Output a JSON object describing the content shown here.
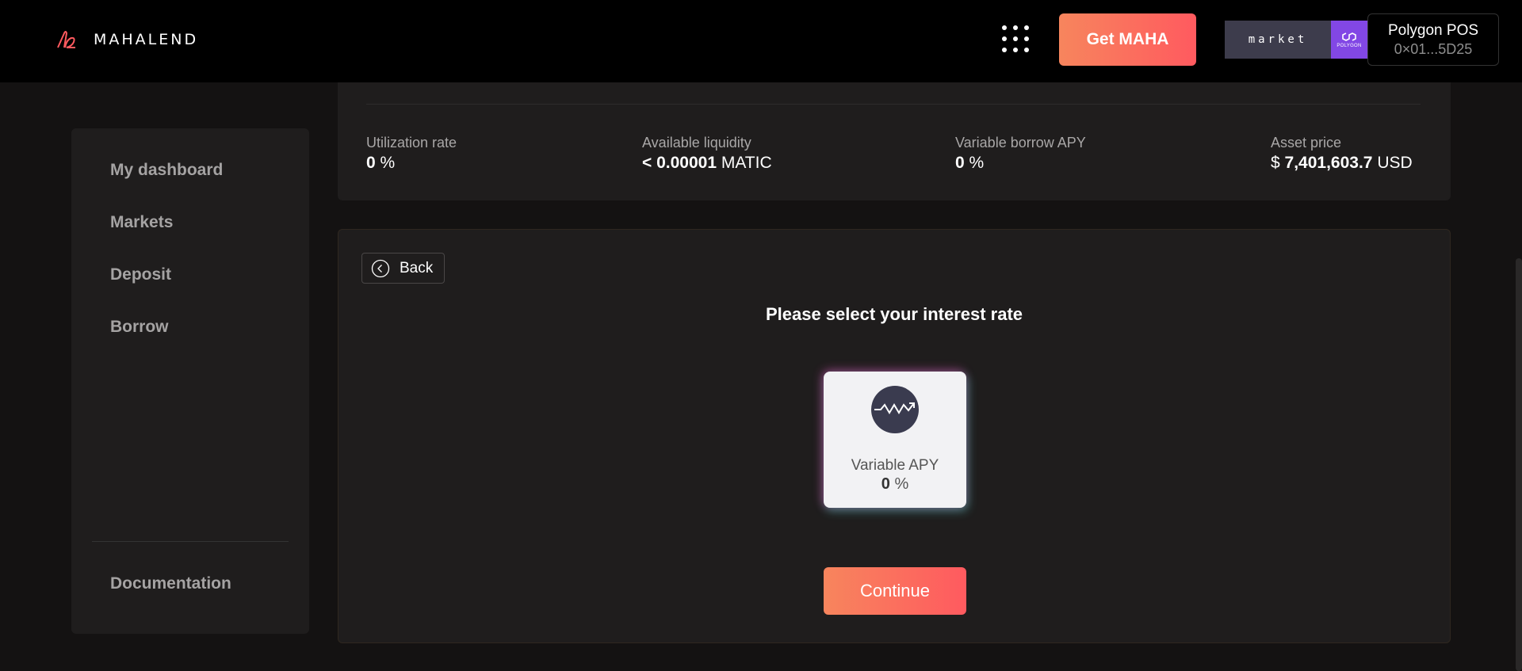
{
  "header": {
    "logo_text": "MAHALEND",
    "get_maha_label": "Get MAHA",
    "market_label": "market",
    "network_chip_label": "POLYGON",
    "wallet_network": "Polygon POS",
    "wallet_address": "0×01...5D25"
  },
  "sidebar": {
    "items": [
      {
        "label": "My dashboard"
      },
      {
        "label": "Markets"
      },
      {
        "label": "Deposit"
      },
      {
        "label": "Borrow"
      }
    ],
    "documentation_label": "Documentation"
  },
  "stats": {
    "utilization": {
      "label": "Utilization rate",
      "value": "0",
      "unit": "%"
    },
    "liquidity": {
      "label": "Available liquidity",
      "value": "< 0.00001",
      "unit": "MATIC"
    },
    "variable_apy": {
      "label": "Variable borrow APY",
      "value": "0",
      "unit": "%"
    },
    "asset_price": {
      "label": "Asset price",
      "prefix": "$",
      "value": "7,401,603.7",
      "unit": "USD"
    }
  },
  "panel": {
    "back_label": "Back",
    "title": "Please select your interest rate",
    "rate_option": {
      "label": "Variable APY",
      "value": "0",
      "unit": "%"
    },
    "continue_label": "Continue"
  },
  "colors": {
    "accent_start": "#f7855d",
    "accent_end": "#ff5a5f",
    "polygon_purple": "#8247e5"
  }
}
